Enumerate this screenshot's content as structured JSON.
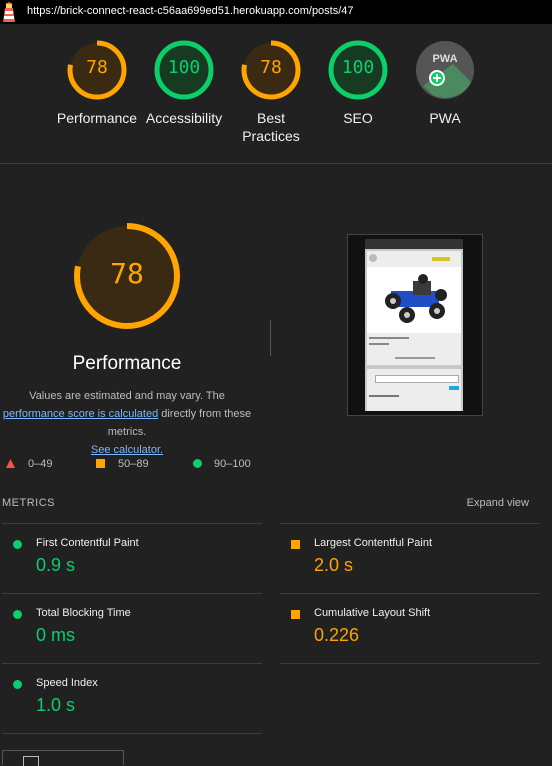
{
  "browser": {
    "url": "https://brick-connect-react-c56aa699ed51.herokuapp.com/posts/47"
  },
  "summary_gauges": [
    {
      "label": "Performance",
      "score": "78",
      "fraction": 0.78,
      "color": "#ffa400"
    },
    {
      "label": "Accessibility",
      "score": "100",
      "fraction": 1.0,
      "color": "#0cce6b"
    },
    {
      "label": "Best Practices",
      "score": "78",
      "fraction": 0.78,
      "color": "#ffa400"
    },
    {
      "label": "SEO",
      "score": "100",
      "fraction": 1.0,
      "color": "#0cce6b"
    },
    {
      "label": "PWA",
      "score": "",
      "fraction": 0,
      "color": "#9e9e9e"
    }
  ],
  "performance": {
    "score": "78",
    "fraction": 0.78,
    "title": "Performance",
    "desc_prefix": "Values are estimated and may vary. The ",
    "desc_link": "performance score is calculated",
    "desc_middle": " directly from these metrics. ",
    "desc_link2": "See calculator."
  },
  "legend": [
    {
      "range": "0–49",
      "color": "#ff4e42",
      "shape": "triangle"
    },
    {
      "range": "50–89",
      "color": "#ffa400",
      "shape": "square"
    },
    {
      "range": "90–100",
      "color": "#0cce6b",
      "shape": "circle"
    }
  ],
  "metrics": {
    "title": "METRICS",
    "expand_label": "Expand view",
    "items": [
      {
        "name": "First Contentful Paint",
        "value": "0.9 s",
        "color": "#0cce6b",
        "shape": "circle"
      },
      {
        "name": "Largest Contentful Paint",
        "value": "2.0 s",
        "color": "#ffa400",
        "shape": "square"
      },
      {
        "name": "Total Blocking Time",
        "value": "0 ms",
        "color": "#0cce6b",
        "shape": "circle"
      },
      {
        "name": "Cumulative Layout Shift",
        "value": "0.226",
        "color": "#ffa400",
        "shape": "square"
      },
      {
        "name": "Speed Index",
        "value": "1.0 s",
        "color": "#0cce6b",
        "shape": "circle"
      }
    ]
  },
  "pwa_badge": "PWA"
}
